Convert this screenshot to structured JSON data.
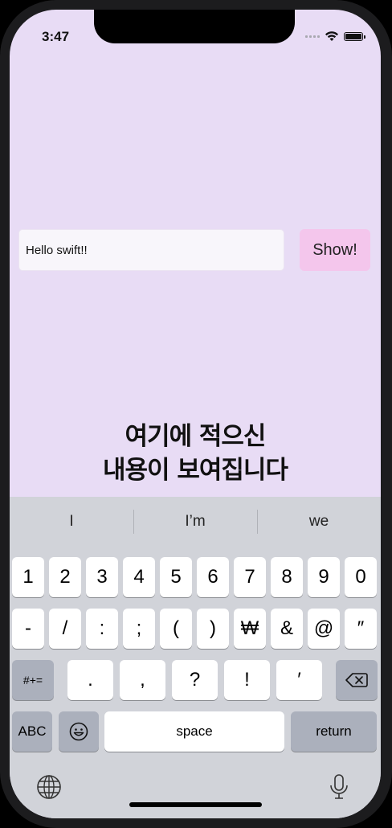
{
  "status": {
    "time": "3:47"
  },
  "input": {
    "value": "Hello swift!!"
  },
  "show_button": {
    "label": "Show!"
  },
  "result_label": {
    "line1": "여기에 적으신",
    "line2": "내용이 보여집니다"
  },
  "keyboard": {
    "suggestions": [
      "I",
      "I’m",
      "we"
    ],
    "row1": [
      "1",
      "2",
      "3",
      "4",
      "5",
      "6",
      "7",
      "8",
      "9",
      "0"
    ],
    "row2": [
      "-",
      "/",
      ":",
      ";",
      "(",
      ")",
      "₩",
      "&",
      "@",
      "″"
    ],
    "row3": {
      "mode_key": "#+=",
      "keys": [
        ".",
        ",",
        "?",
        "!",
        "′"
      ]
    },
    "row4": {
      "abc": "ABC",
      "space": "space",
      "return": "return"
    }
  },
  "colors": {
    "background": "#e8dcf5",
    "button": "#f4c6ec",
    "keyboard": "#d1d3d9"
  }
}
